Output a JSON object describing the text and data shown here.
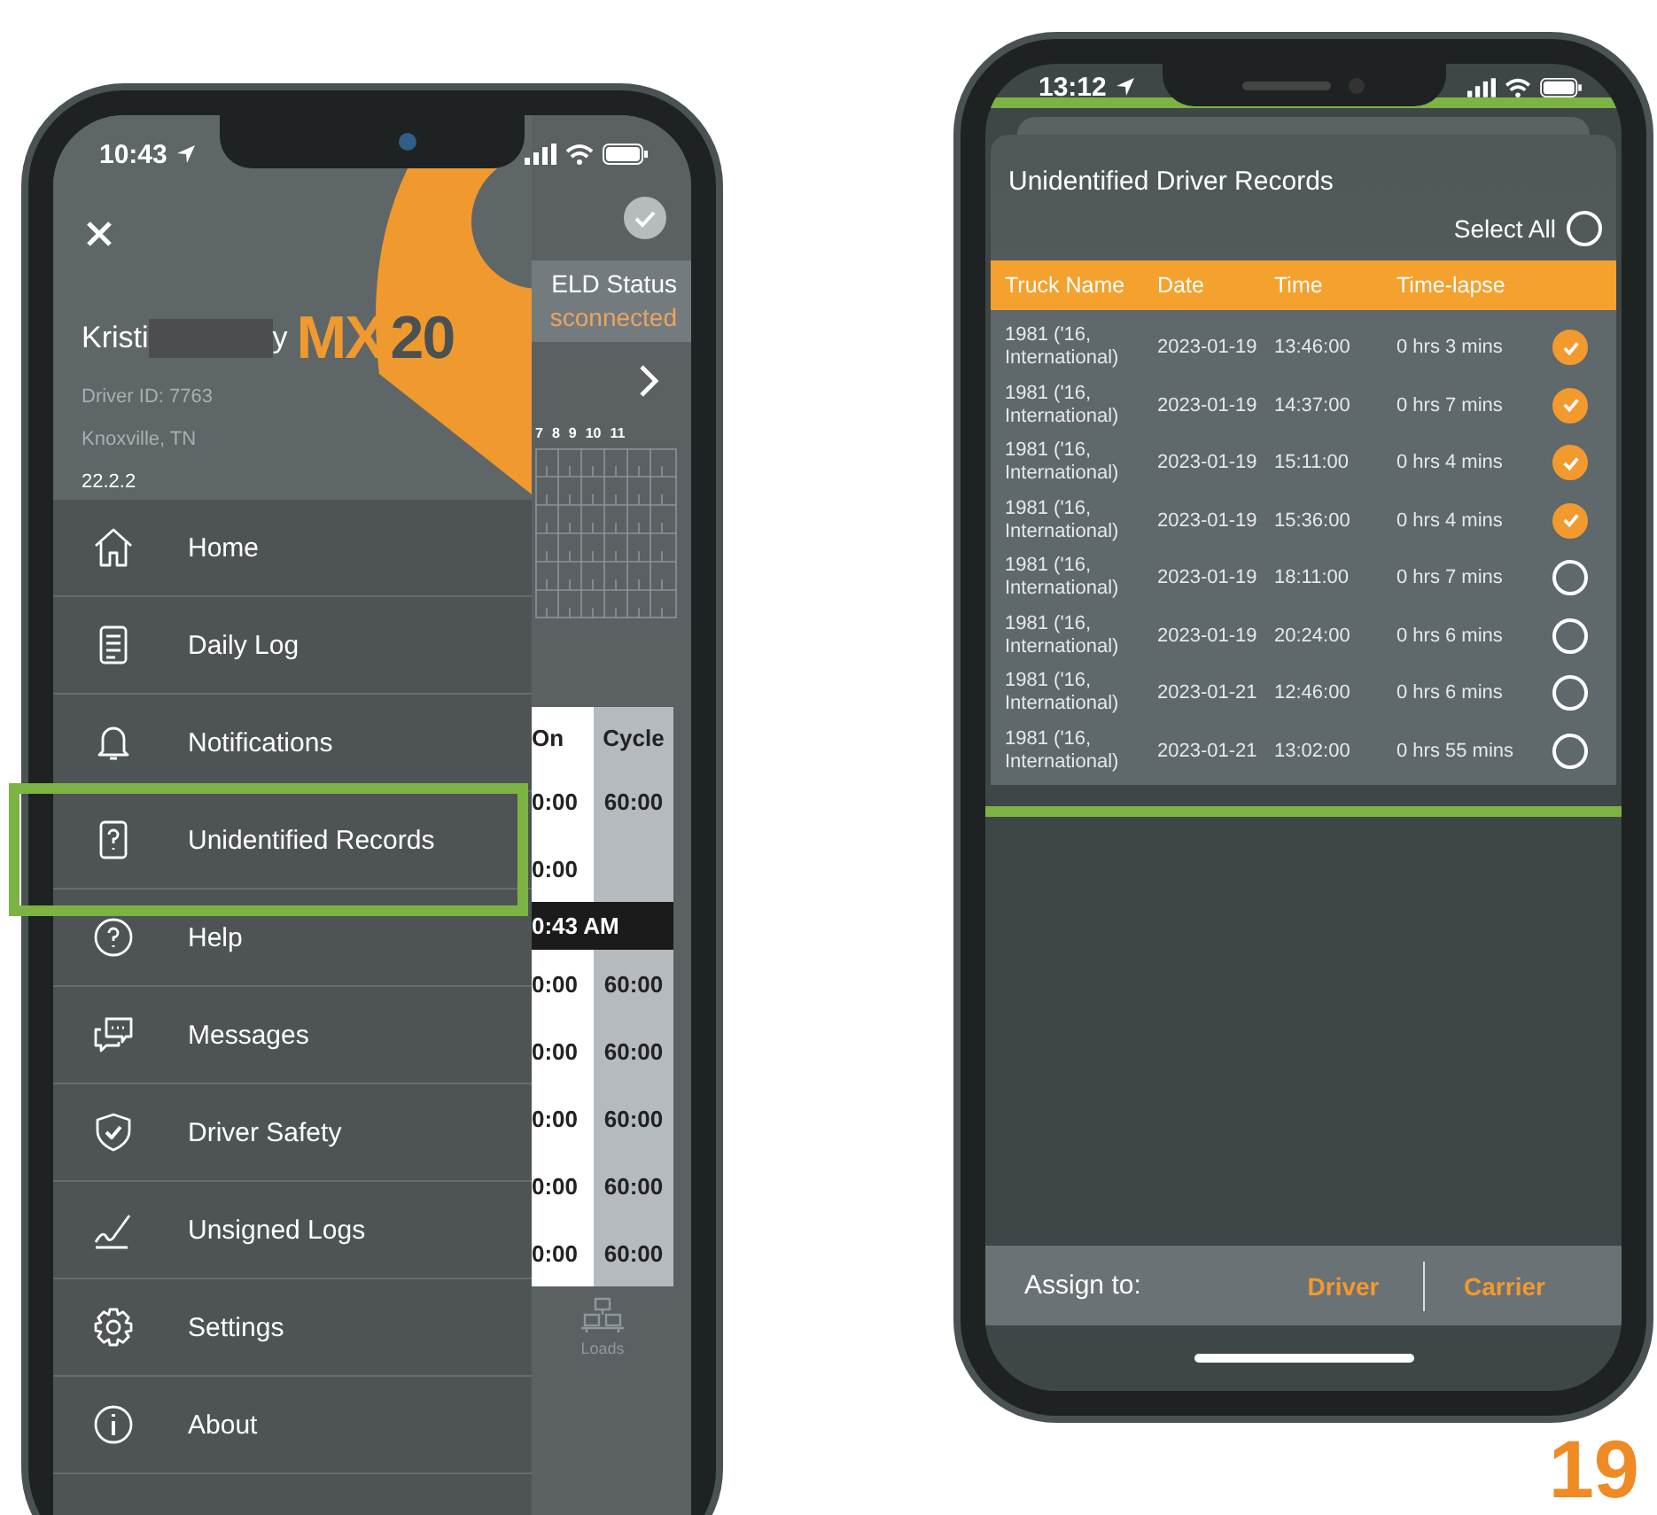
{
  "left_phone": {
    "status_bar": {
      "time": "10:43"
    },
    "drawer": {
      "driver": {
        "name_start": "Kristi",
        "name_end": "y",
        "driver_id": "Driver ID: 7763",
        "location": "Knoxville, TN",
        "version": "22.2.2"
      },
      "logo": {
        "orange_part": "MX",
        "gray_part": "20"
      },
      "menu": [
        {
          "kind": "home",
          "label": "Home",
          "highlighted": false
        },
        {
          "kind": "log",
          "label": "Daily Log",
          "highlighted": false
        },
        {
          "kind": "bell",
          "label": "Notifications",
          "highlighted": false
        },
        {
          "kind": "records",
          "label": "Unidentified Records",
          "highlighted": true
        },
        {
          "kind": "help",
          "label": "Help",
          "highlighted": false
        },
        {
          "kind": "messages",
          "label": "Messages",
          "highlighted": false
        },
        {
          "kind": "safety",
          "label": "Driver Safety",
          "highlighted": false
        },
        {
          "kind": "signature",
          "label": "Unsigned Logs",
          "highlighted": false
        },
        {
          "kind": "settings",
          "label": "Settings",
          "highlighted": false
        },
        {
          "kind": "about",
          "label": "About",
          "highlighted": false
        }
      ]
    },
    "background_screen": {
      "eld_status": {
        "label": "ELD Status",
        "value": "sconnected"
      },
      "hours": [
        "7",
        "8",
        "9",
        "10",
        "11"
      ],
      "table": {
        "columns": [
          "On",
          "Cycle"
        ],
        "rows_before": [
          {
            "on": "0:00",
            "cycle": "60:00"
          },
          {
            "on": "0:00"
          }
        ],
        "time_bar": "0:43 AM",
        "rows_after": [
          {
            "on": "0:00",
            "cycle": "60:00"
          },
          {
            "on": "0:00",
            "cycle": "60:00"
          },
          {
            "on": "0:00",
            "cycle": "60:00"
          },
          {
            "on": "0:00",
            "cycle": "60:00"
          },
          {
            "on": "0:00",
            "cycle": "60:00"
          }
        ]
      },
      "tab": {
        "label": "Loads"
      }
    }
  },
  "right_phone": {
    "status_bar": {
      "time": "13:12"
    },
    "records_dialog": {
      "title": "Unidentified Driver Records",
      "highlighted": true,
      "select_all": {
        "label": "Select All",
        "checked": false
      },
      "columns": [
        "Truck Name",
        "Date",
        "Time",
        "Time-lapse"
      ],
      "rows": [
        {
          "truck": "1981 ('16, International)",
          "date": "2023-01-19",
          "time": "13:46:00",
          "lapse": "0 hrs 3 mins",
          "checked": true
        },
        {
          "truck": "1981 ('16, International)",
          "date": "2023-01-19",
          "time": "14:37:00",
          "lapse": "0 hrs 7 mins",
          "checked": true
        },
        {
          "truck": "1981 ('16, International)",
          "date": "2023-01-19",
          "time": "15:11:00",
          "lapse": "0 hrs 4 mins",
          "checked": true
        },
        {
          "truck": "1981 ('16, International)",
          "date": "2023-01-19",
          "time": "15:36:00",
          "lapse": "0 hrs 4 mins",
          "checked": true
        },
        {
          "truck": "1981 ('16, International)",
          "date": "2023-01-19",
          "time": "18:11:00",
          "lapse": "0 hrs 7 mins",
          "checked": false
        },
        {
          "truck": "1981 ('16, International)",
          "date": "2023-01-19",
          "time": "20:24:00",
          "lapse": "0 hrs 6 mins",
          "checked": false
        },
        {
          "truck": "1981 ('16, International)",
          "date": "2023-01-21",
          "time": "12:46:00",
          "lapse": "0 hrs 6 mins",
          "checked": false
        },
        {
          "truck": "1981 ('16, International)",
          "date": "2023-01-21",
          "time": "13:02:00",
          "lapse": "0 hrs 55 mins",
          "checked": false
        }
      ]
    },
    "assign_bar": {
      "label": "Assign to:",
      "buttons": [
        "Driver",
        "Carrier"
      ]
    }
  },
  "page_number": "19"
}
